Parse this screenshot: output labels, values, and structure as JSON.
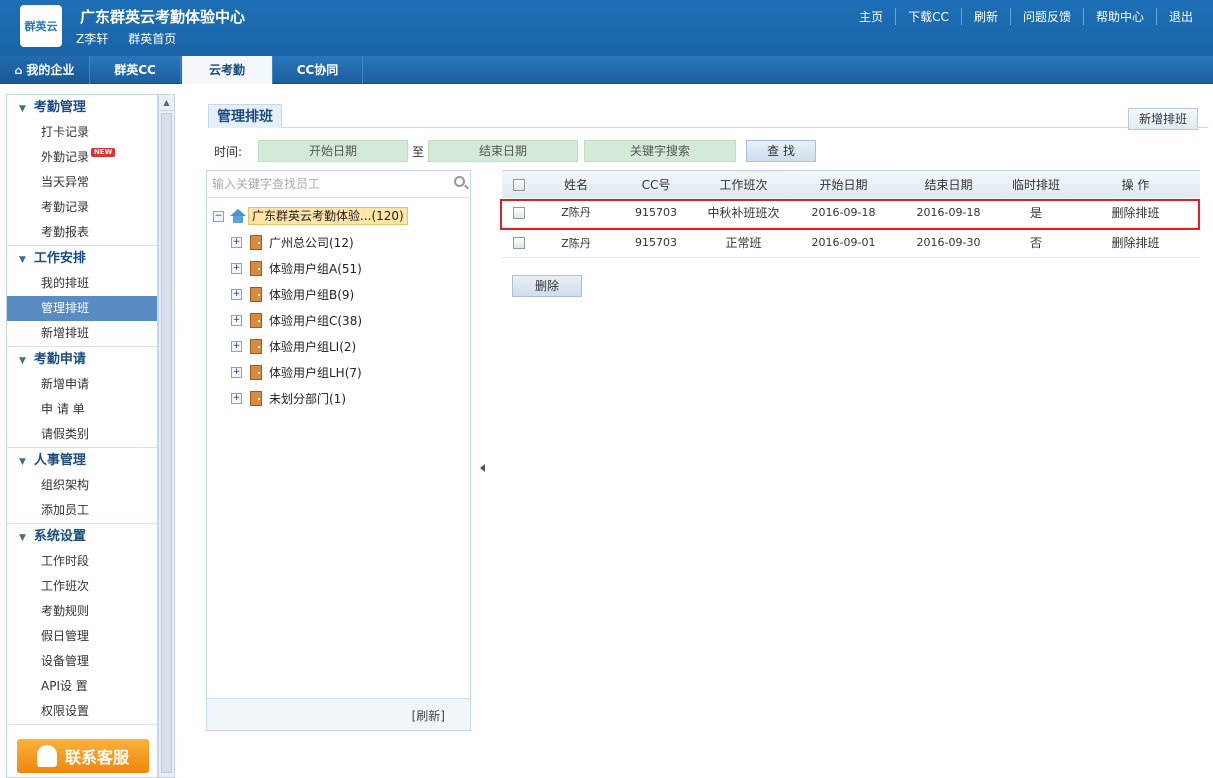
{
  "header": {
    "logo_text": "群英云",
    "title": "广东群英云考勤体验中心",
    "user": "Z李轩",
    "home_link": "群英首页",
    "links": [
      "主页",
      "下载CC",
      "刷新",
      "问题反馈",
      "帮助中心",
      "退出"
    ]
  },
  "nav": {
    "tabs": [
      "我的企业",
      "群英CC",
      "云考勤",
      "CC协同"
    ],
    "active": "云考勤"
  },
  "sidebar": {
    "groups": [
      {
        "title": "考勤管理",
        "items": [
          "打卡记录",
          "外勤记录",
          "当天异常",
          "考勤记录",
          "考勤报表"
        ]
      },
      {
        "title": "工作安排",
        "items": [
          "我的排班",
          "管理排班",
          "新增排班"
        ]
      },
      {
        "title": "考勤申请",
        "items": [
          "新增申请",
          "申 请 单",
          "请假类别"
        ]
      },
      {
        "title": "人事管理",
        "items": [
          "组织架构",
          "添加员工"
        ]
      },
      {
        "title": "系统设置",
        "items": [
          "工作时段",
          "工作班次",
          "考勤规则",
          "假日管理",
          "设备管理",
          "API设 置",
          "权限设置"
        ]
      }
    ],
    "new_badge": "NEW",
    "active_item": "管理排班",
    "contact_button": "联系客服"
  },
  "main": {
    "title": "管理排班",
    "add_button": "新增排班",
    "search": {
      "time_label": "时间:",
      "start_placeholder": "开始日期",
      "to_label": "至",
      "end_placeholder": "结束日期",
      "keyword_placeholder": "关键字搜索",
      "find_button": "查 找"
    },
    "tree": {
      "search_placeholder": "输入关键字查找员工",
      "root": "广东群英云考勤体验...(120)",
      "nodes": [
        "广州总公司(12)",
        "体验用户组A(51)",
        "体验用户组B(9)",
        "体验用户组C(38)",
        "体验用户组LI(2)",
        "体验用户组LH(7)",
        "未划分部门(1)"
      ],
      "refresh": "[刷新]"
    },
    "table": {
      "columns": [
        "姓名",
        "CC号",
        "工作班次",
        "开始日期",
        "结束日期",
        "临时排班",
        "操 作"
      ],
      "rows": [
        {
          "name": "Z陈丹",
          "cc": "915703",
          "shift": "中秋补班班次",
          "start": "2016-09-18",
          "end": "2016-09-18",
          "temp": "是",
          "action": "删除排班"
        },
        {
          "name": "Z陈丹",
          "cc": "915703",
          "shift": "正常班",
          "start": "2016-09-01",
          "end": "2016-09-30",
          "temp": "否",
          "action": "删除排班"
        }
      ]
    },
    "delete_button": "删除"
  }
}
